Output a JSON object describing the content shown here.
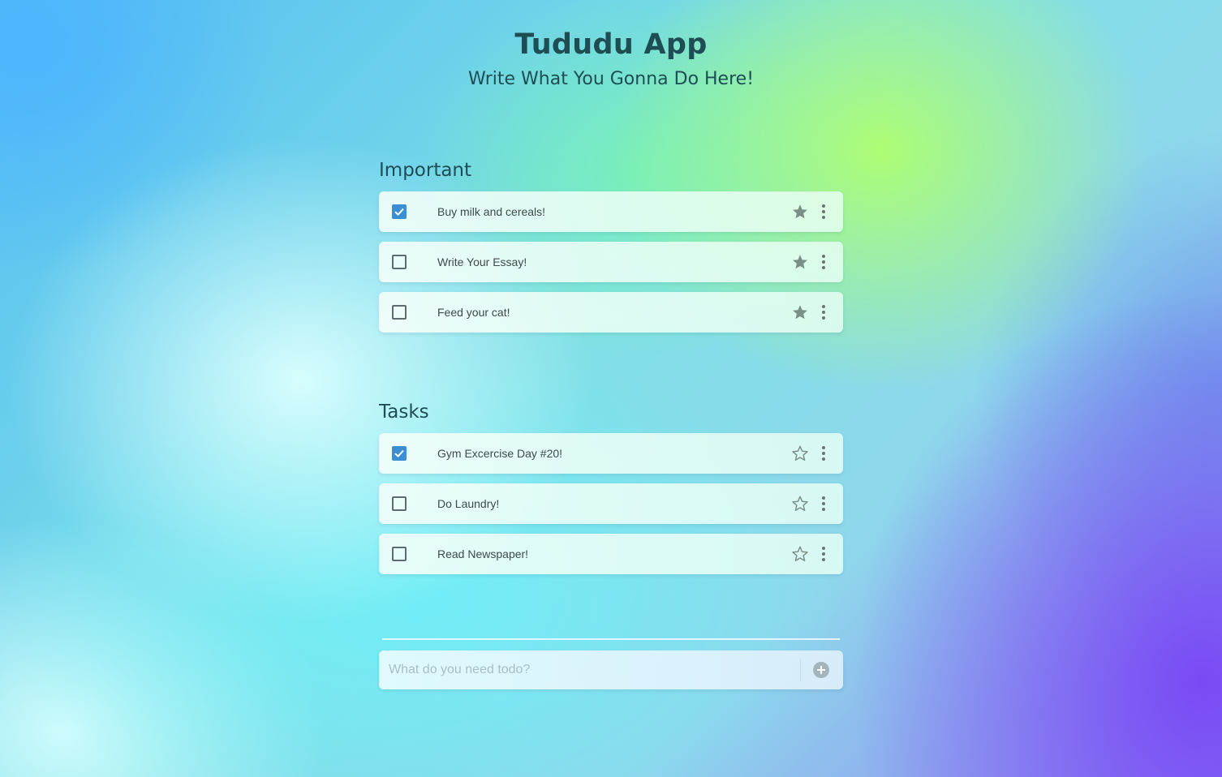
{
  "app": {
    "title": "Tududu App",
    "subtitle": "Write What You Gonna Do Here!"
  },
  "colors": {
    "checkbox_checked": "#3a8fd4",
    "heading_text": "#1e4d54",
    "star_icon": "#7a8f86"
  },
  "sections": [
    {
      "title": "Important",
      "items": [
        {
          "label": "Buy milk and cereals!",
          "checked": true,
          "starred": true
        },
        {
          "label": "Write Your Essay!",
          "checked": false,
          "starred": true
        },
        {
          "label": "Feed your cat!",
          "checked": false,
          "starred": true
        }
      ]
    },
    {
      "title": "Tasks",
      "items": [
        {
          "label": "Gym Excercise Day #20!",
          "checked": true,
          "starred": false
        },
        {
          "label": "Do Laundry!",
          "checked": false,
          "starred": false
        },
        {
          "label": "Read Newspaper!",
          "checked": false,
          "starred": false
        }
      ]
    }
  ],
  "new_todo": {
    "placeholder": "What do you need todo?",
    "value": "",
    "add_icon": "plus-circle-icon"
  },
  "icons": {
    "checkbox": "checkbox-icon",
    "star_filled": "star-filled-icon",
    "star_outline": "star-outline-icon",
    "menu": "more-vertical-icon"
  }
}
